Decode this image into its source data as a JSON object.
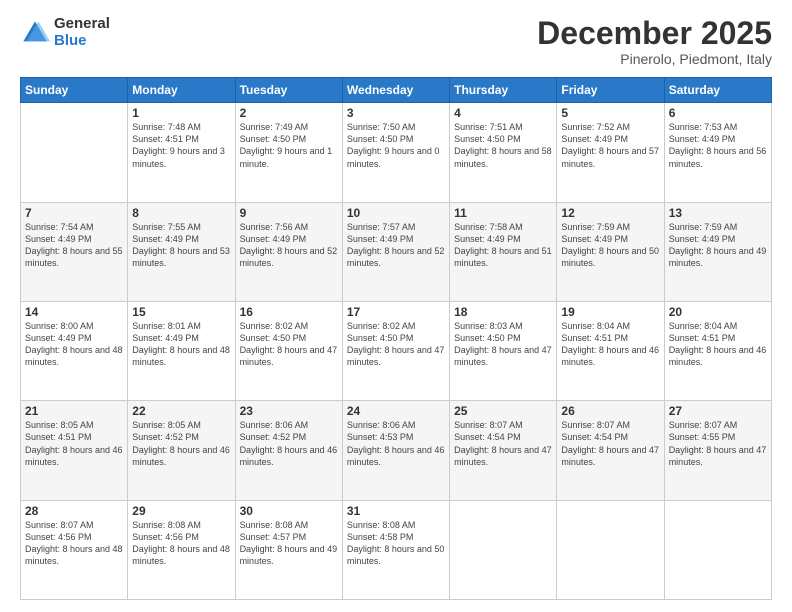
{
  "logo": {
    "general": "General",
    "blue": "Blue"
  },
  "header": {
    "month": "December 2025",
    "location": "Pinerolo, Piedmont, Italy"
  },
  "weekdays": [
    "Sunday",
    "Monday",
    "Tuesday",
    "Wednesday",
    "Thursday",
    "Friday",
    "Saturday"
  ],
  "weeks": [
    [
      {
        "day": "",
        "sunrise": "",
        "sunset": "",
        "daylight": ""
      },
      {
        "day": "1",
        "sunrise": "Sunrise: 7:48 AM",
        "sunset": "Sunset: 4:51 PM",
        "daylight": "Daylight: 9 hours and 3 minutes."
      },
      {
        "day": "2",
        "sunrise": "Sunrise: 7:49 AM",
        "sunset": "Sunset: 4:50 PM",
        "daylight": "Daylight: 9 hours and 1 minute."
      },
      {
        "day": "3",
        "sunrise": "Sunrise: 7:50 AM",
        "sunset": "Sunset: 4:50 PM",
        "daylight": "Daylight: 9 hours and 0 minutes."
      },
      {
        "day": "4",
        "sunrise": "Sunrise: 7:51 AM",
        "sunset": "Sunset: 4:50 PM",
        "daylight": "Daylight: 8 hours and 58 minutes."
      },
      {
        "day": "5",
        "sunrise": "Sunrise: 7:52 AM",
        "sunset": "Sunset: 4:49 PM",
        "daylight": "Daylight: 8 hours and 57 minutes."
      },
      {
        "day": "6",
        "sunrise": "Sunrise: 7:53 AM",
        "sunset": "Sunset: 4:49 PM",
        "daylight": "Daylight: 8 hours and 56 minutes."
      }
    ],
    [
      {
        "day": "7",
        "sunrise": "Sunrise: 7:54 AM",
        "sunset": "Sunset: 4:49 PM",
        "daylight": "Daylight: 8 hours and 55 minutes."
      },
      {
        "day": "8",
        "sunrise": "Sunrise: 7:55 AM",
        "sunset": "Sunset: 4:49 PM",
        "daylight": "Daylight: 8 hours and 53 minutes."
      },
      {
        "day": "9",
        "sunrise": "Sunrise: 7:56 AM",
        "sunset": "Sunset: 4:49 PM",
        "daylight": "Daylight: 8 hours and 52 minutes."
      },
      {
        "day": "10",
        "sunrise": "Sunrise: 7:57 AM",
        "sunset": "Sunset: 4:49 PM",
        "daylight": "Daylight: 8 hours and 52 minutes."
      },
      {
        "day": "11",
        "sunrise": "Sunrise: 7:58 AM",
        "sunset": "Sunset: 4:49 PM",
        "daylight": "Daylight: 8 hours and 51 minutes."
      },
      {
        "day": "12",
        "sunrise": "Sunrise: 7:59 AM",
        "sunset": "Sunset: 4:49 PM",
        "daylight": "Daylight: 8 hours and 50 minutes."
      },
      {
        "day": "13",
        "sunrise": "Sunrise: 7:59 AM",
        "sunset": "Sunset: 4:49 PM",
        "daylight": "Daylight: 8 hours and 49 minutes."
      }
    ],
    [
      {
        "day": "14",
        "sunrise": "Sunrise: 8:00 AM",
        "sunset": "Sunset: 4:49 PM",
        "daylight": "Daylight: 8 hours and 48 minutes."
      },
      {
        "day": "15",
        "sunrise": "Sunrise: 8:01 AM",
        "sunset": "Sunset: 4:49 PM",
        "daylight": "Daylight: 8 hours and 48 minutes."
      },
      {
        "day": "16",
        "sunrise": "Sunrise: 8:02 AM",
        "sunset": "Sunset: 4:50 PM",
        "daylight": "Daylight: 8 hours and 47 minutes."
      },
      {
        "day": "17",
        "sunrise": "Sunrise: 8:02 AM",
        "sunset": "Sunset: 4:50 PM",
        "daylight": "Daylight: 8 hours and 47 minutes."
      },
      {
        "day": "18",
        "sunrise": "Sunrise: 8:03 AM",
        "sunset": "Sunset: 4:50 PM",
        "daylight": "Daylight: 8 hours and 47 minutes."
      },
      {
        "day": "19",
        "sunrise": "Sunrise: 8:04 AM",
        "sunset": "Sunset: 4:51 PM",
        "daylight": "Daylight: 8 hours and 46 minutes."
      },
      {
        "day": "20",
        "sunrise": "Sunrise: 8:04 AM",
        "sunset": "Sunset: 4:51 PM",
        "daylight": "Daylight: 8 hours and 46 minutes."
      }
    ],
    [
      {
        "day": "21",
        "sunrise": "Sunrise: 8:05 AM",
        "sunset": "Sunset: 4:51 PM",
        "daylight": "Daylight: 8 hours and 46 minutes."
      },
      {
        "day": "22",
        "sunrise": "Sunrise: 8:05 AM",
        "sunset": "Sunset: 4:52 PM",
        "daylight": "Daylight: 8 hours and 46 minutes."
      },
      {
        "day": "23",
        "sunrise": "Sunrise: 8:06 AM",
        "sunset": "Sunset: 4:52 PM",
        "daylight": "Daylight: 8 hours and 46 minutes."
      },
      {
        "day": "24",
        "sunrise": "Sunrise: 8:06 AM",
        "sunset": "Sunset: 4:53 PM",
        "daylight": "Daylight: 8 hours and 46 minutes."
      },
      {
        "day": "25",
        "sunrise": "Sunrise: 8:07 AM",
        "sunset": "Sunset: 4:54 PM",
        "daylight": "Daylight: 8 hours and 47 minutes."
      },
      {
        "day": "26",
        "sunrise": "Sunrise: 8:07 AM",
        "sunset": "Sunset: 4:54 PM",
        "daylight": "Daylight: 8 hours and 47 minutes."
      },
      {
        "day": "27",
        "sunrise": "Sunrise: 8:07 AM",
        "sunset": "Sunset: 4:55 PM",
        "daylight": "Daylight: 8 hours and 47 minutes."
      }
    ],
    [
      {
        "day": "28",
        "sunrise": "Sunrise: 8:07 AM",
        "sunset": "Sunset: 4:56 PM",
        "daylight": "Daylight: 8 hours and 48 minutes."
      },
      {
        "day": "29",
        "sunrise": "Sunrise: 8:08 AM",
        "sunset": "Sunset: 4:56 PM",
        "daylight": "Daylight: 8 hours and 48 minutes."
      },
      {
        "day": "30",
        "sunrise": "Sunrise: 8:08 AM",
        "sunset": "Sunset: 4:57 PM",
        "daylight": "Daylight: 8 hours and 49 minutes."
      },
      {
        "day": "31",
        "sunrise": "Sunrise: 8:08 AM",
        "sunset": "Sunset: 4:58 PM",
        "daylight": "Daylight: 8 hours and 50 minutes."
      },
      {
        "day": "",
        "sunrise": "",
        "sunset": "",
        "daylight": ""
      },
      {
        "day": "",
        "sunrise": "",
        "sunset": "",
        "daylight": ""
      },
      {
        "day": "",
        "sunrise": "",
        "sunset": "",
        "daylight": ""
      }
    ]
  ]
}
